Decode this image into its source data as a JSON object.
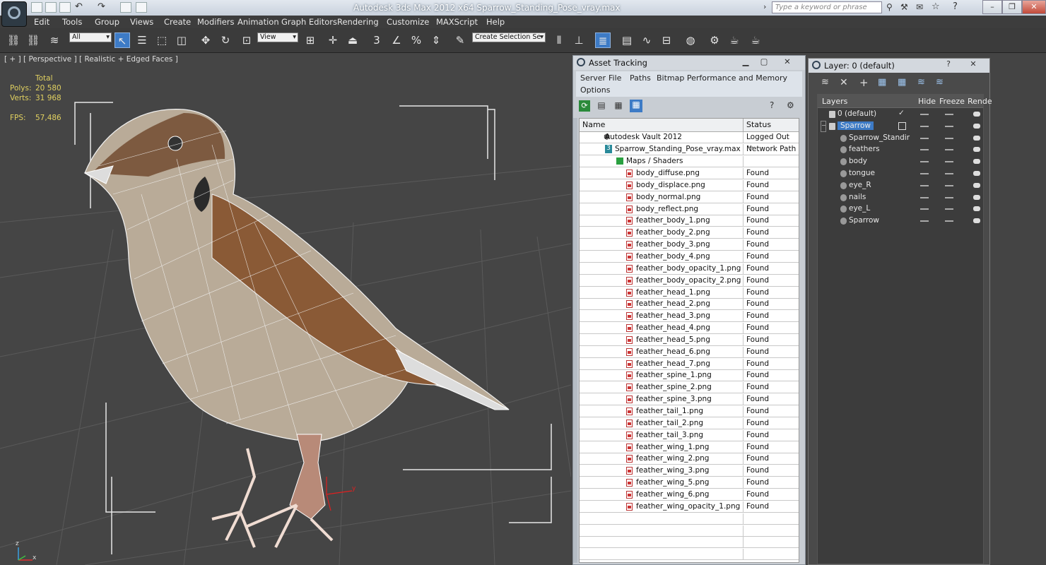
{
  "titlebar": {
    "title": "Autodesk 3ds Max  2012 x64      Sparrow_Standing_Pose_vray.max",
    "search_placeholder": "Type a keyword or phrase"
  },
  "menu": [
    "Edit",
    "Tools",
    "Group",
    "Views",
    "Create",
    "Modifiers",
    "Animation",
    "Graph Editors",
    "Rendering",
    "Customize",
    "MAXScript",
    "Help"
  ],
  "toolbar": {
    "filter_select": "All",
    "ref_coord_select": "View",
    "selection_set": "Create Selection Se"
  },
  "viewport": {
    "label": "[ + ] [ Perspective ] [ Realistic + Edged Faces ]",
    "stats_header": "Total",
    "polys_label": "Polys:",
    "polys_value": "20 580",
    "verts_label": "Verts:",
    "verts_value": "31 968",
    "fps_label": "FPS:",
    "fps_value": "57,486",
    "axis_x": "x",
    "axis_y": "y",
    "axis_z": "z"
  },
  "asset_tracking": {
    "title": "Asset Tracking",
    "menu": [
      "Server",
      "File",
      "Paths",
      "Bitmap Performance and Memory"
    ],
    "menu_options": "Options",
    "col_name": "Name",
    "col_status": "Status",
    "vault_name": "Autodesk Vault 2012",
    "vault_status": "Logged Out ...",
    "scene_name": "Sparrow_Standing_Pose_vray.max",
    "scene_status": "Network Path",
    "maps_label": "Maps / Shaders",
    "files": [
      {
        "name": "body_diffuse.png",
        "status": "Found"
      },
      {
        "name": "body_displace.png",
        "status": "Found"
      },
      {
        "name": "body_normal.png",
        "status": "Found"
      },
      {
        "name": "body_reflect.png",
        "status": "Found"
      },
      {
        "name": "feather_body_1.png",
        "status": "Found"
      },
      {
        "name": "feather_body_2.png",
        "status": "Found"
      },
      {
        "name": "feather_body_3.png",
        "status": "Found"
      },
      {
        "name": "feather_body_4.png",
        "status": "Found"
      },
      {
        "name": "feather_body_opacity_1.png",
        "status": "Found"
      },
      {
        "name": "feather_body_opacity_2.png",
        "status": "Found"
      },
      {
        "name": "feather_head_1.png",
        "status": "Found"
      },
      {
        "name": "feather_head_2.png",
        "status": "Found"
      },
      {
        "name": "feather_head_3.png",
        "status": "Found"
      },
      {
        "name": "feather_head_4.png",
        "status": "Found"
      },
      {
        "name": "feather_head_5.png",
        "status": "Found"
      },
      {
        "name": "feather_head_6.png",
        "status": "Found"
      },
      {
        "name": "feather_head_7.png",
        "status": "Found"
      },
      {
        "name": "feather_spine_1.png",
        "status": "Found"
      },
      {
        "name": "feather_spine_2.png",
        "status": "Found"
      },
      {
        "name": "feather_spine_3.png",
        "status": "Found"
      },
      {
        "name": "feather_tail_1.png",
        "status": "Found"
      },
      {
        "name": "feather_tail_2.png",
        "status": "Found"
      },
      {
        "name": "feather_tail_3.png",
        "status": "Found"
      },
      {
        "name": "feather_wing_1.png",
        "status": "Found"
      },
      {
        "name": "feather_wing_2.png",
        "status": "Found"
      },
      {
        "name": "feather_wing_3.png",
        "status": "Found"
      },
      {
        "name": "feather_wing_5.png",
        "status": "Found"
      },
      {
        "name": "feather_wing_6.png",
        "status": "Found"
      },
      {
        "name": "feather_wing_opacity_1.png",
        "status": "Found"
      }
    ]
  },
  "layer_panel": {
    "title": "Layer: 0 (default)",
    "col_layers": "Layers",
    "col_hide": "Hide",
    "col_freeze": "Freeze",
    "col_render": "Rende",
    "layers": [
      "0 (default)",
      "Sparrow"
    ],
    "objects": [
      "Sparrow_Standir",
      "feathers",
      "body",
      "tongue",
      "eye_R",
      "nails",
      "eye_L",
      "Sparrow"
    ]
  },
  "colors": {
    "accent": "#3d7bc6",
    "viewport_bg": "#454545",
    "stats_yellow": "#e0d060"
  }
}
